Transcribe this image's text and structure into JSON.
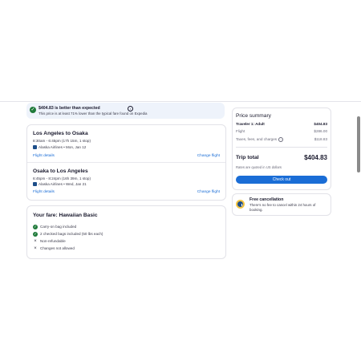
{
  "banner": {
    "title": "$404.83 is better than expected",
    "info_icon": "i",
    "subtitle": "This price is at least 71% lower than the typical fare found on Expedia",
    "badge_icon": "check-icon"
  },
  "flights": [
    {
      "route": "Los Angeles to Osaka",
      "times": "8:30am - 6:45pm (17h 15m, 1 stop)",
      "airline": "Alaska Airlines • Mon, Jan 12",
      "details_link": "Flight details",
      "change_link": "Change flight"
    },
    {
      "route": "Osaka to Los Angeles",
      "times": "6:45pm - 8:24pm (16h 39m, 1 stop)",
      "airline": "Alaska Airlines • Wed, Jan 21",
      "details_link": "Flight details",
      "change_link": "Change flight"
    }
  ],
  "fare": {
    "title": "Your fare: Hawaiian Basic",
    "features": [
      {
        "text": "Carry-on bag included",
        "included": true
      },
      {
        "text": "2 checked bags included (50 lbs each)",
        "included": true
      },
      {
        "text": "Non-refundable",
        "included": false
      },
      {
        "text": "Changes not allowed",
        "included": false
      }
    ]
  },
  "price_summary": {
    "title": "Price summary",
    "traveler_label": "Traveler 1: Adult",
    "traveler_value": "$404.83",
    "flight_label": "Flight",
    "flight_value": "$286.00",
    "taxes_label": "Taxes, fees, and charges",
    "taxes_value": "$118.83",
    "total_label": "Trip total",
    "total_value": "$404.83",
    "quoted_note": "Rates are quoted in US dollars",
    "checkout_label": "Check out"
  },
  "cancellation": {
    "title": "Free cancellation",
    "text": "There's no fee to cancel within 24 hours of booking.",
    "icon": "clock-icon"
  },
  "colors": {
    "accent": "#1a6dd6",
    "success": "#1f7a3a",
    "banner_bg": "#eef3fb"
  }
}
